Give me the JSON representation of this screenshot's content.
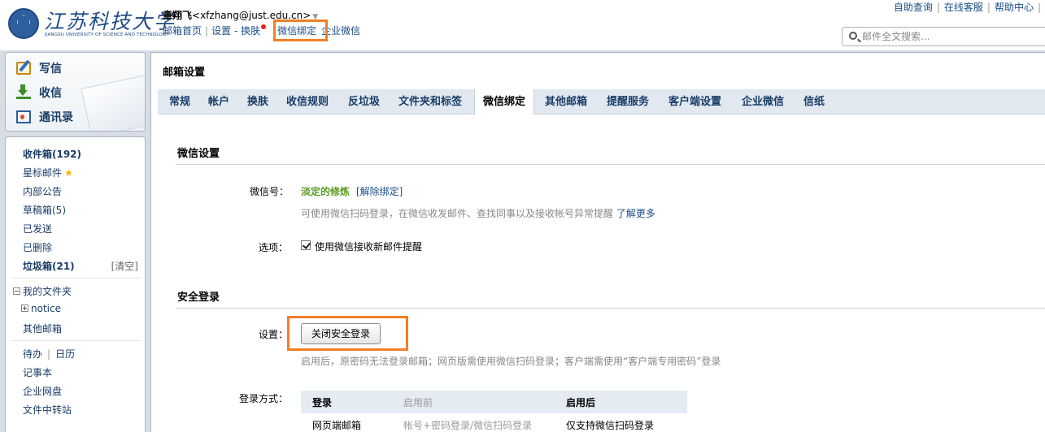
{
  "header": {
    "logo_cn": "江苏科技大学",
    "logo_en": "JIANGSU UNIVERSITY OF SCIENCE AND TECHNOLOGY",
    "user_name": "章翔飞",
    "user_email": "<xfzhang@just.edu.cn>",
    "nav": [
      "邮箱首页",
      "设置",
      "换肤",
      "微信绑定",
      "企业微信"
    ],
    "top_links": [
      "自助查询",
      "在线客服",
      "帮助中心"
    ],
    "search_placeholder": "邮件全文搜索...",
    "highlight_color": "#f07f26"
  },
  "sidebar": {
    "write": "写信",
    "receive": "收信",
    "contacts": "通讯录",
    "folders": {
      "inbox": "收件箱(192)",
      "starred": "星标邮件",
      "notice_board": "内部公告",
      "drafts": "草稿箱(5)",
      "sent": "已发送",
      "deleted": "已删除",
      "spam": "垃圾箱(21)",
      "spam_clear": "[清空]",
      "my_folders": "我的文件夹",
      "notice": "notice",
      "other_mailbox": "其他邮箱",
      "todo": "待办",
      "calendar": "日历",
      "notes": "记事本",
      "netdisk": "企业网盘",
      "file_transfer": "文件中转站"
    }
  },
  "main": {
    "title": "邮箱设置",
    "tabs": [
      "常规",
      "帐户",
      "换肤",
      "收信规则",
      "反垃圾",
      "文件夹和标签",
      "微信绑定",
      "其他邮箱",
      "提醒服务",
      "客户端设置",
      "企业微信",
      "信纸"
    ],
    "active_tab": "微信绑定",
    "wechat": {
      "section_title": "微信设置",
      "id_label": "微信号：",
      "id_value": "淡定的修炼",
      "unbind": "[解除绑定]",
      "desc": "可使用微信扫码登录，在微信收发邮件、查找同事以及接收帐号异常提醒",
      "learn_more": "了解更多",
      "option_label": "选项：",
      "option_text": "使用微信接收新邮件提醒"
    },
    "secure": {
      "section_title": "安全登录",
      "setting_label": "设置：",
      "button": "关闭安全登录",
      "desc": "启用后，原密码无法登录邮箱；网页版需使用微信扫码登录；客户端需使用“客户端专用密码”登录",
      "method_label": "登录方式：",
      "table": {
        "headers": [
          "登录",
          "启用前",
          "启用后"
        ],
        "rows": [
          [
            "网页端邮箱",
            "帐号+密码登录/微信扫码登录",
            "仅支持微信扫码登录"
          ]
        ]
      }
    }
  }
}
